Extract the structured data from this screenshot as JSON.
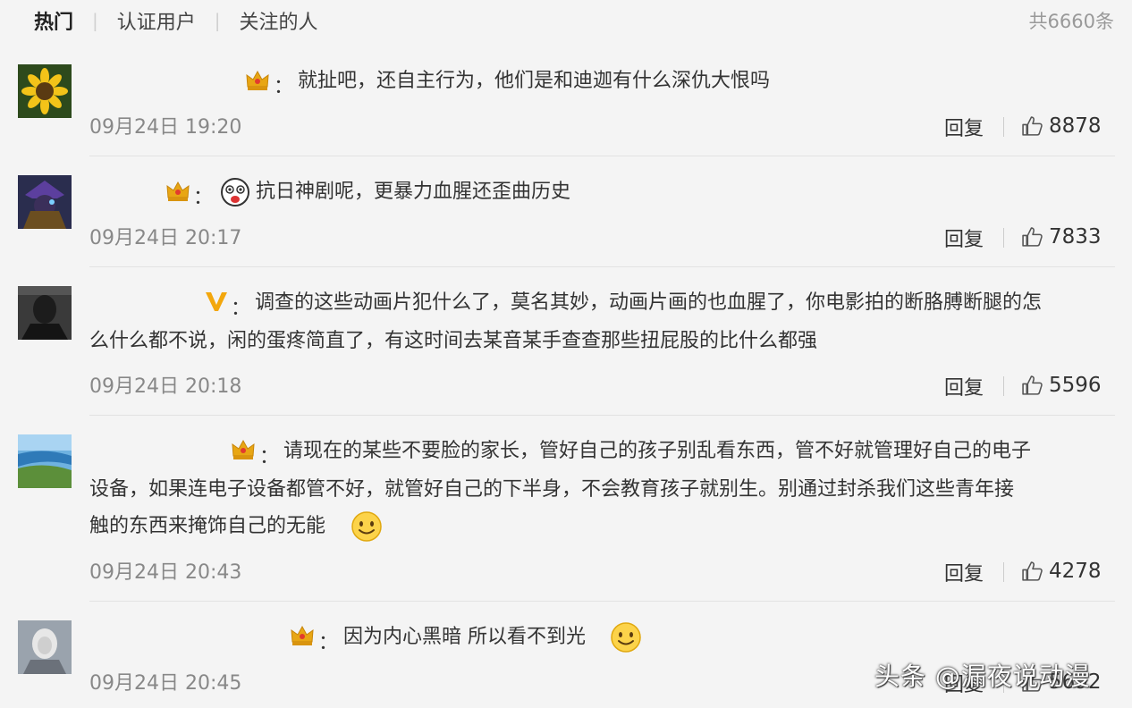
{
  "tabs": [
    "热门",
    "认证用户",
    "关注的人"
  ],
  "total": "共6660条",
  "reply_label": "回复",
  "watermark": "头条 @漏夜说动漫",
  "comments": [
    {
      "badge": "crown",
      "text": "就扯吧，还自主行为，他们是和迪迦有什么深仇大恨吗",
      "time": "09月24日 19:20",
      "likes": "8878"
    },
    {
      "badge": "crown",
      "text": "抗日神剧呢，更暴力血腥还歪曲历史",
      "time": "09月24日 20:17",
      "likes": "7833"
    },
    {
      "badge": "V",
      "text": "调查的这些动画片犯什么了，莫名其妙，动画片画的也血腥了，你电影拍的断胳膊断腿的怎",
      "text2": "么什么都不说，闲的蛋疼简直了，有这时间去某音某手查查那些扭屁股的比什么都强",
      "time": "09月24日 20:18",
      "likes": "5596"
    },
    {
      "badge": "crown",
      "text": "请现在的某些不要脸的家长，管好自己的孩子别乱看东西，管不好就管理好自己的电子",
      "text2": "设备，如果连电子设备都管不好，就管好自己的下半身，不会教育孩子就别生。别通过封杀我们这些青年接",
      "text3": "触的东西来掩饰自己的无能",
      "time": "09月24日 20:43",
      "likes": "4278"
    },
    {
      "badge": "crown",
      "text": "因为内心黑暗 所以看不到光",
      "time": "09月24日 20:45",
      "likes": "5692"
    }
  ],
  "colors": {
    "background": "#f4f4f4",
    "crown": "#e8a614",
    "v_badge": "#f3a70d",
    "timestamp": "#888888"
  }
}
